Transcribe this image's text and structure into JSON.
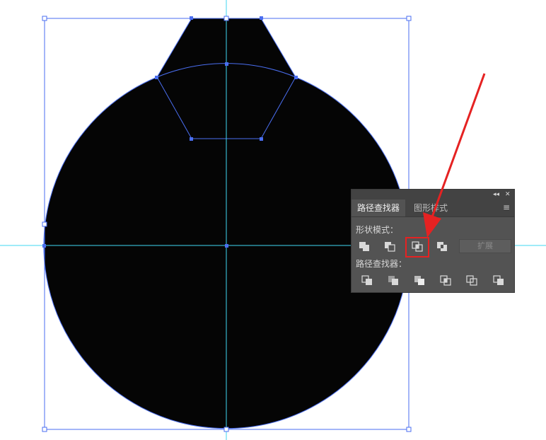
{
  "panel": {
    "collapse_icon": "double-chevron-left-icon",
    "close_icon": "close-icon",
    "tabs": [
      {
        "label": "路径查找器",
        "active": true
      },
      {
        "label": "图形样式",
        "active": false
      }
    ],
    "menu_icon": "hamburger-menu-icon",
    "shape_modes": {
      "label": "形状模式：",
      "buttons": [
        "unite-icon",
        "minus-front-icon",
        "intersect-icon",
        "exclude-icon"
      ],
      "highlighted_index": 2,
      "expand_label": "扩展"
    },
    "pathfinders": {
      "label": "路径查找器：",
      "buttons": [
        "divide-icon",
        "trim-icon",
        "merge-icon",
        "crop-icon",
        "outline-icon",
        "minus-back-icon"
      ]
    }
  },
  "colors": {
    "shape_fill": "#050505",
    "path_stroke": "#4a6ef0",
    "guide": "#3fd7f2",
    "panel_bg": "#535353",
    "annotation": "#e52222"
  }
}
